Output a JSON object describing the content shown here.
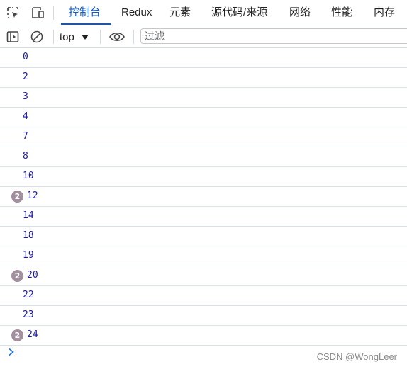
{
  "devtools": {
    "tabs": [
      {
        "label": "控制台",
        "active": true
      },
      {
        "label": "Redux",
        "active": false
      },
      {
        "label": "元素",
        "active": false
      },
      {
        "label": "源代码/来源",
        "active": false
      },
      {
        "label": "网络",
        "active": false
      },
      {
        "label": "性能",
        "active": false
      },
      {
        "label": "内存",
        "active": false
      }
    ],
    "icons": {
      "inspect": "inspect-element-icon",
      "device": "device-toolbar-icon"
    },
    "accent_color": "#0b57d0"
  },
  "console_toolbar": {
    "context": "top",
    "filter_placeholder": "过滤",
    "icons": {
      "sidebar": "sidebar-toggle-icon",
      "clear": "clear-console-icon",
      "eye": "live-expression-eye-icon"
    }
  },
  "console_log": [
    {
      "value": "0",
      "count": null
    },
    {
      "value": "2",
      "count": null
    },
    {
      "value": "3",
      "count": null
    },
    {
      "value": "4",
      "count": null
    },
    {
      "value": "7",
      "count": null
    },
    {
      "value": "8",
      "count": null
    },
    {
      "value": "10",
      "count": null
    },
    {
      "value": "12",
      "count": "2"
    },
    {
      "value": "14",
      "count": null
    },
    {
      "value": "18",
      "count": null
    },
    {
      "value": "19",
      "count": null
    },
    {
      "value": "20",
      "count": "2"
    },
    {
      "value": "22",
      "count": null
    },
    {
      "value": "23",
      "count": null
    },
    {
      "value": "24",
      "count": "2"
    }
  ],
  "watermark": "CSDN @WongLeer"
}
